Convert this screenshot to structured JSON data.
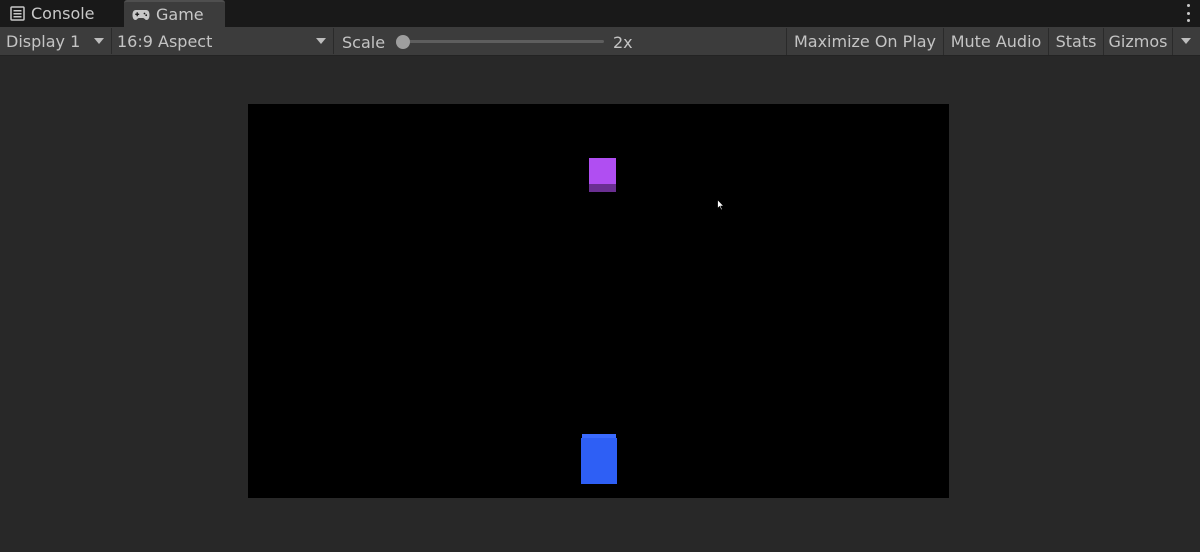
{
  "tabs": [
    {
      "label": "Console",
      "icon": "console-icon"
    },
    {
      "label": "Game",
      "icon": "gamepad-icon",
      "active": true
    }
  ],
  "toolbar": {
    "display_value": "Display 1",
    "aspect_value": "16:9 Aspect",
    "scale_label": "Scale",
    "scale_value": "2x",
    "maximize_label": "Maximize On Play",
    "mute_label": "Mute Audio",
    "stats_label": "Stats",
    "gizmos_label": "Gizmos"
  },
  "scene": {
    "objects": [
      {
        "name": "purple-cube",
        "color": "#b04ef2"
      },
      {
        "name": "blue-cube",
        "color": "#2e5ff5"
      }
    ]
  },
  "colors": {
    "panel_bg": "#282828",
    "toolbar_bg": "#3c3c3c",
    "tabbar_bg": "#191919",
    "viewport_bg": "#000000"
  }
}
